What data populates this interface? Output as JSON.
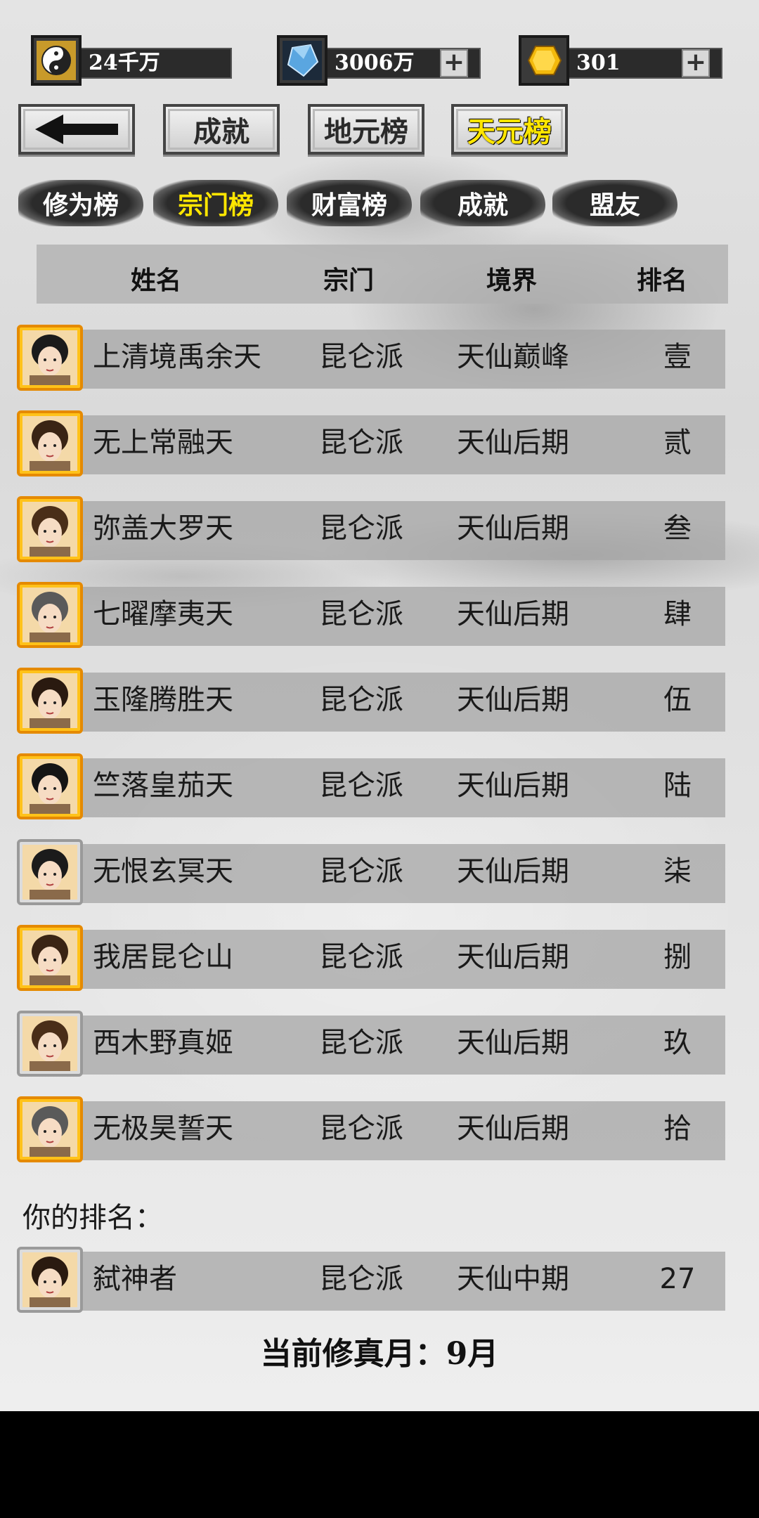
{
  "resources": [
    {
      "icon": "taiji-icon",
      "value": "24千万",
      "has_plus": false
    },
    {
      "icon": "crystal-icon",
      "value": "3006万",
      "has_plus": true
    },
    {
      "icon": "gold-gem-icon",
      "value": "301",
      "has_plus": true
    }
  ],
  "top_tabs": {
    "back_icon": "back-arrow-icon",
    "achievement": "成就",
    "earth_rank": "地元榜",
    "heaven_rank": "天元榜",
    "active": "天元榜"
  },
  "sub_tabs": [
    "修为榜",
    "宗门榜",
    "财富榜",
    "成就",
    "盟友"
  ],
  "sub_tab_active": "宗门榜",
  "table": {
    "headers": [
      "姓名",
      "宗门",
      "境界",
      "排名"
    ],
    "rows": [
      {
        "name": "上清境禹余天",
        "sect": "昆仑派",
        "realm": "天仙巅峰",
        "rank": "壹",
        "frame": "gold"
      },
      {
        "name": "无上常融天",
        "sect": "昆仑派",
        "realm": "天仙后期",
        "rank": "贰",
        "frame": "gold"
      },
      {
        "name": "弥盖大罗天",
        "sect": "昆仑派",
        "realm": "天仙后期",
        "rank": "叁",
        "frame": "gold"
      },
      {
        "name": "七曜摩夷天",
        "sect": "昆仑派",
        "realm": "天仙后期",
        "rank": "肆",
        "frame": "gold"
      },
      {
        "name": "玉隆腾胜天",
        "sect": "昆仑派",
        "realm": "天仙后期",
        "rank": "伍",
        "frame": "gold"
      },
      {
        "name": "竺落皇茄天",
        "sect": "昆仑派",
        "realm": "天仙后期",
        "rank": "陆",
        "frame": "gold"
      },
      {
        "name": "无恨玄冥天",
        "sect": "昆仑派",
        "realm": "天仙后期",
        "rank": "柒",
        "frame": "silver"
      },
      {
        "name": "我居昆仑山",
        "sect": "昆仑派",
        "realm": "天仙后期",
        "rank": "捌",
        "frame": "gold"
      },
      {
        "name": "西木野真姬",
        "sect": "昆仑派",
        "realm": "天仙后期",
        "rank": "玖",
        "frame": "silver"
      },
      {
        "name": "无极昊誓天",
        "sect": "昆仑派",
        "realm": "天仙后期",
        "rank": "拾",
        "frame": "gold"
      }
    ]
  },
  "your_rank_label": "你的排名：",
  "your_rank": {
    "name": "弑神者",
    "sect": "昆仑派",
    "realm": "天仙中期",
    "rank": "27",
    "frame": "silver"
  },
  "current_month": "当前修真月：9月"
}
